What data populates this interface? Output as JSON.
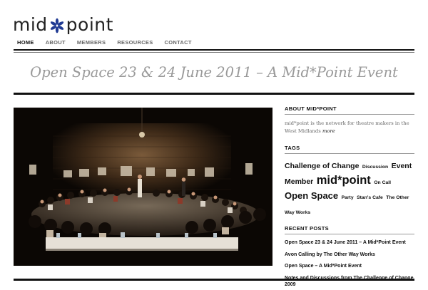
{
  "brand": {
    "logo_left": "mid",
    "logo_right": "point",
    "star_color": "#1f3a93"
  },
  "nav": {
    "items": [
      "HOME",
      "ABOUT",
      "MEMBERS",
      "RESOURCES",
      "CONTACT"
    ],
    "active": "HOME"
  },
  "page": {
    "title": "Open Space 23 & 24 June 2011 – A Mid*Point Event"
  },
  "sidebar": {
    "about": {
      "heading": "ABOUT MID*POINT",
      "text": "mid*point is the network for theatre makers in the West Midlands",
      "more": "more"
    },
    "tags": {
      "heading": "TAGS",
      "items": [
        {
          "label": "Challenge of Change",
          "size": "md"
        },
        {
          "label": "Discussion",
          "size": "sm"
        },
        {
          "label": "Event",
          "size": "md"
        },
        {
          "label": "Member",
          "size": "md"
        },
        {
          "label": "mid*point",
          "size": "xl"
        },
        {
          "label": "On Call",
          "size": "sm"
        },
        {
          "label": "Open Space",
          "size": "lg"
        },
        {
          "label": "Party",
          "size": "sm"
        },
        {
          "label": "Stan's Cafe",
          "size": "sm"
        },
        {
          "label": "The Other Way Works",
          "size": "sm"
        }
      ]
    },
    "recent_posts": {
      "heading": "RECENT POSTS",
      "items": [
        "Open Space 23 & 24 June 2011 – A Mid*Point Event",
        "Avon Calling by The Other Way Works",
        "Open Space – A Mid*Point Event",
        "Notes and Discussions from The Challenge of Change 2009"
      ]
    }
  },
  "colors": {
    "accent": "#1f3a93",
    "rule": "#111111",
    "title": "#999999",
    "muted": "#666666"
  }
}
